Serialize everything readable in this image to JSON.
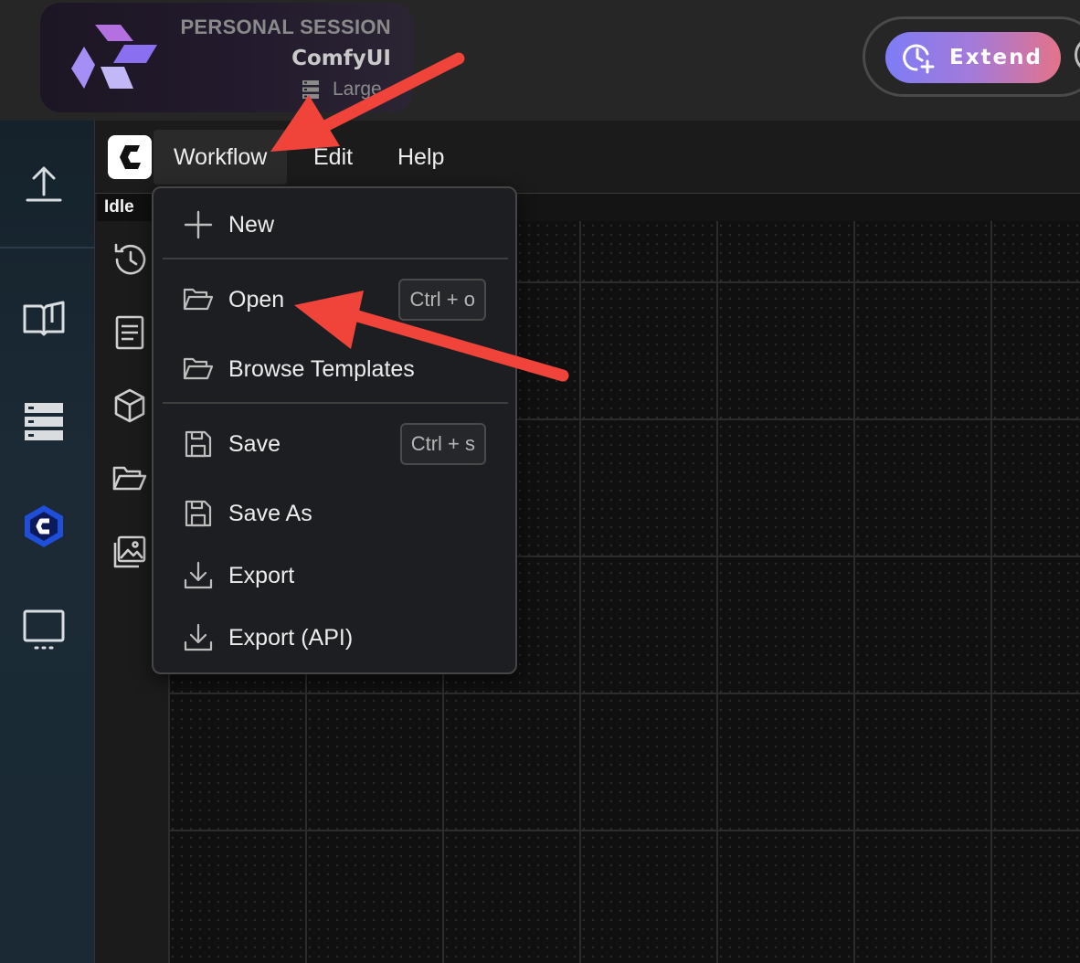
{
  "session": {
    "kicker": "PERSONAL SESSION",
    "app_name": "ComfyUI",
    "size_label": "Large"
  },
  "extend": {
    "label": "Extend"
  },
  "sidebar": {
    "icons": [
      "upload-icon",
      "book-icon",
      "server-icon",
      "comfy-hex-icon",
      "monitor-icon"
    ]
  },
  "menubar": {
    "items": [
      {
        "label": "Workflow"
      },
      {
        "label": "Edit"
      },
      {
        "label": "Help"
      }
    ]
  },
  "status": "Idle",
  "workflow_menu": {
    "items": [
      {
        "label": "New",
        "icon": "plus-icon"
      },
      {
        "label": "Open",
        "icon": "folder-open-icon",
        "shortcut": "Ctrl + o"
      },
      {
        "label": "Browse Templates",
        "icon": "folder-open-icon"
      },
      {
        "label": "Save",
        "icon": "save-icon",
        "shortcut": "Ctrl + s"
      },
      {
        "label": "Save As",
        "icon": "save-icon"
      },
      {
        "label": "Export",
        "icon": "download-icon"
      },
      {
        "label": "Export (API)",
        "icon": "download-icon"
      }
    ]
  },
  "colors": {
    "annotation_arrow": "#f0433a",
    "extend_gradient_start": "#7d7cf6",
    "extend_gradient_end": "#e3738a"
  }
}
